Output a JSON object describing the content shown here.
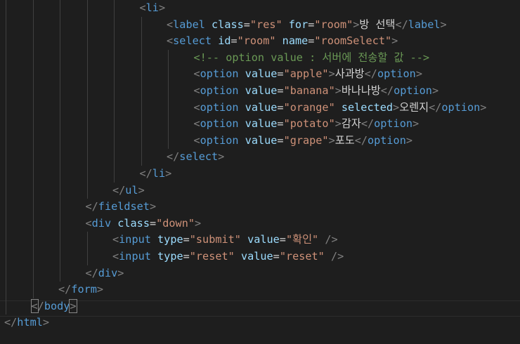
{
  "editor": {
    "lines": [
      {
        "indent": 5,
        "tokens": [
          {
            "t": "<",
            "c": "punc"
          },
          {
            "t": "li",
            "c": "tag"
          },
          {
            "t": ">",
            "c": "punc"
          }
        ]
      },
      {
        "indent": 6,
        "tokens": [
          {
            "t": "<",
            "c": "punc"
          },
          {
            "t": "label",
            "c": "tag"
          },
          {
            "t": " ",
            "c": "txt"
          },
          {
            "t": "class",
            "c": "attr"
          },
          {
            "t": "=",
            "c": "eq"
          },
          {
            "t": "\"res\"",
            "c": "str"
          },
          {
            "t": " ",
            "c": "txt"
          },
          {
            "t": "for",
            "c": "attr"
          },
          {
            "t": "=",
            "c": "eq"
          },
          {
            "t": "\"room\"",
            "c": "str"
          },
          {
            "t": ">",
            "c": "punc"
          },
          {
            "t": "방 선택",
            "c": "txt"
          },
          {
            "t": "</",
            "c": "punc"
          },
          {
            "t": "label",
            "c": "tag"
          },
          {
            "t": ">",
            "c": "punc"
          }
        ]
      },
      {
        "indent": 6,
        "tokens": [
          {
            "t": "<",
            "c": "punc"
          },
          {
            "t": "select",
            "c": "tag"
          },
          {
            "t": " ",
            "c": "txt"
          },
          {
            "t": "id",
            "c": "attr"
          },
          {
            "t": "=",
            "c": "eq"
          },
          {
            "t": "\"room\"",
            "c": "str"
          },
          {
            "t": " ",
            "c": "txt"
          },
          {
            "t": "name",
            "c": "attr"
          },
          {
            "t": "=",
            "c": "eq"
          },
          {
            "t": "\"roomSelect\"",
            "c": "str"
          },
          {
            "t": ">",
            "c": "punc"
          }
        ]
      },
      {
        "indent": 7,
        "tokens": [
          {
            "t": "<!-- option value : 서버에 전송할 값 -->",
            "c": "cmt"
          }
        ]
      },
      {
        "indent": 7,
        "tokens": [
          {
            "t": "<",
            "c": "punc"
          },
          {
            "t": "option",
            "c": "tag"
          },
          {
            "t": " ",
            "c": "txt"
          },
          {
            "t": "value",
            "c": "attr"
          },
          {
            "t": "=",
            "c": "eq"
          },
          {
            "t": "\"apple\"",
            "c": "str"
          },
          {
            "t": ">",
            "c": "punc"
          },
          {
            "t": "사과방",
            "c": "txt"
          },
          {
            "t": "</",
            "c": "punc"
          },
          {
            "t": "option",
            "c": "tag"
          },
          {
            "t": ">",
            "c": "punc"
          }
        ]
      },
      {
        "indent": 7,
        "tokens": [
          {
            "t": "<",
            "c": "punc"
          },
          {
            "t": "option",
            "c": "tag"
          },
          {
            "t": " ",
            "c": "txt"
          },
          {
            "t": "value",
            "c": "attr"
          },
          {
            "t": "=",
            "c": "eq"
          },
          {
            "t": "\"banana\"",
            "c": "str"
          },
          {
            "t": ">",
            "c": "punc"
          },
          {
            "t": "바나나방",
            "c": "txt"
          },
          {
            "t": "</",
            "c": "punc"
          },
          {
            "t": "option",
            "c": "tag"
          },
          {
            "t": ">",
            "c": "punc"
          }
        ]
      },
      {
        "indent": 7,
        "tokens": [
          {
            "t": "<",
            "c": "punc"
          },
          {
            "t": "option",
            "c": "tag"
          },
          {
            "t": " ",
            "c": "txt"
          },
          {
            "t": "value",
            "c": "attr"
          },
          {
            "t": "=",
            "c": "eq"
          },
          {
            "t": "\"orange\"",
            "c": "str"
          },
          {
            "t": " ",
            "c": "txt"
          },
          {
            "t": "selected",
            "c": "attr"
          },
          {
            "t": ">",
            "c": "punc"
          },
          {
            "t": "오렌지",
            "c": "txt"
          },
          {
            "t": "</",
            "c": "punc"
          },
          {
            "t": "option",
            "c": "tag"
          },
          {
            "t": ">",
            "c": "punc"
          }
        ]
      },
      {
        "indent": 7,
        "tokens": [
          {
            "t": "<",
            "c": "punc"
          },
          {
            "t": "option",
            "c": "tag"
          },
          {
            "t": " ",
            "c": "txt"
          },
          {
            "t": "value",
            "c": "attr"
          },
          {
            "t": "=",
            "c": "eq"
          },
          {
            "t": "\"potato\"",
            "c": "str"
          },
          {
            "t": ">",
            "c": "punc"
          },
          {
            "t": "감자",
            "c": "txt"
          },
          {
            "t": "</",
            "c": "punc"
          },
          {
            "t": "option",
            "c": "tag"
          },
          {
            "t": ">",
            "c": "punc"
          }
        ]
      },
      {
        "indent": 7,
        "tokens": [
          {
            "t": "<",
            "c": "punc"
          },
          {
            "t": "option",
            "c": "tag"
          },
          {
            "t": " ",
            "c": "txt"
          },
          {
            "t": "value",
            "c": "attr"
          },
          {
            "t": "=",
            "c": "eq"
          },
          {
            "t": "\"grape\"",
            "c": "str"
          },
          {
            "t": ">",
            "c": "punc"
          },
          {
            "t": "포도",
            "c": "txt"
          },
          {
            "t": "</",
            "c": "punc"
          },
          {
            "t": "option",
            "c": "tag"
          },
          {
            "t": ">",
            "c": "punc"
          }
        ]
      },
      {
        "indent": 6,
        "tokens": [
          {
            "t": "</",
            "c": "punc"
          },
          {
            "t": "select",
            "c": "tag"
          },
          {
            "t": ">",
            "c": "punc"
          }
        ]
      },
      {
        "indent": 5,
        "tokens": [
          {
            "t": "</",
            "c": "punc"
          },
          {
            "t": "li",
            "c": "tag"
          },
          {
            "t": ">",
            "c": "punc"
          }
        ]
      },
      {
        "indent": 4,
        "tokens": [
          {
            "t": "</",
            "c": "punc"
          },
          {
            "t": "ul",
            "c": "tag"
          },
          {
            "t": ">",
            "c": "punc"
          }
        ]
      },
      {
        "indent": 3,
        "tokens": [
          {
            "t": "</",
            "c": "punc"
          },
          {
            "t": "fieldset",
            "c": "tag"
          },
          {
            "t": ">",
            "c": "punc"
          }
        ]
      },
      {
        "indent": 3,
        "tokens": [
          {
            "t": "<",
            "c": "punc"
          },
          {
            "t": "div",
            "c": "tag"
          },
          {
            "t": " ",
            "c": "txt"
          },
          {
            "t": "class",
            "c": "attr"
          },
          {
            "t": "=",
            "c": "eq"
          },
          {
            "t": "\"down\"",
            "c": "str"
          },
          {
            "t": ">",
            "c": "punc"
          }
        ]
      },
      {
        "indent": 4,
        "tokens": [
          {
            "t": "<",
            "c": "punc"
          },
          {
            "t": "input",
            "c": "tag"
          },
          {
            "t": " ",
            "c": "txt"
          },
          {
            "t": "type",
            "c": "attr"
          },
          {
            "t": "=",
            "c": "eq"
          },
          {
            "t": "\"submit\"",
            "c": "str"
          },
          {
            "t": " ",
            "c": "txt"
          },
          {
            "t": "value",
            "c": "attr"
          },
          {
            "t": "=",
            "c": "eq"
          },
          {
            "t": "\"확인\"",
            "c": "str"
          },
          {
            "t": " ",
            "c": "txt"
          },
          {
            "t": "/>",
            "c": "punc"
          }
        ]
      },
      {
        "indent": 4,
        "tokens": [
          {
            "t": "<",
            "c": "punc"
          },
          {
            "t": "input",
            "c": "tag"
          },
          {
            "t": " ",
            "c": "txt"
          },
          {
            "t": "type",
            "c": "attr"
          },
          {
            "t": "=",
            "c": "eq"
          },
          {
            "t": "\"reset\"",
            "c": "str"
          },
          {
            "t": " ",
            "c": "txt"
          },
          {
            "t": "value",
            "c": "attr"
          },
          {
            "t": "=",
            "c": "eq"
          },
          {
            "t": "\"reset\"",
            "c": "str"
          },
          {
            "t": " ",
            "c": "txt"
          },
          {
            "t": "/>",
            "c": "punc"
          }
        ]
      },
      {
        "indent": 3,
        "tokens": [
          {
            "t": "</",
            "c": "punc"
          },
          {
            "t": "div",
            "c": "tag"
          },
          {
            "t": ">",
            "c": "punc"
          }
        ]
      },
      {
        "indent": 2,
        "tokens": [
          {
            "t": "</",
            "c": "punc"
          },
          {
            "t": "form",
            "c": "tag"
          },
          {
            "t": ">",
            "c": "punc"
          }
        ]
      },
      {
        "indent": 1,
        "current": true,
        "tokens": [
          {
            "t": "<",
            "c": "punc",
            "hl": true
          },
          {
            "t": "/",
            "c": "punc"
          },
          {
            "t": "body",
            "c": "tag"
          },
          {
            "t": ">",
            "c": "punc",
            "hl": true
          }
        ]
      },
      {
        "indent": 0,
        "tokens": [
          {
            "t": "</",
            "c": "punc"
          },
          {
            "t": "html",
            "c": "tag"
          },
          {
            "t": ">",
            "c": "punc"
          }
        ]
      }
    ]
  },
  "colors": {
    "background": "#1e1e1e",
    "tag": "#569cd6",
    "attribute": "#9cdcfe",
    "string": "#ce9178",
    "comment": "#6a9955",
    "punctuation": "#808080",
    "text": "#d4d4d4"
  }
}
